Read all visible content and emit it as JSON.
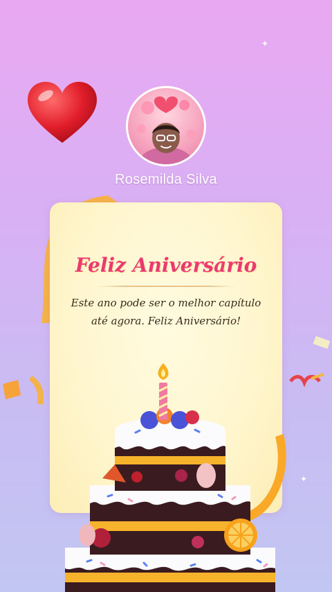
{
  "profile": {
    "name": "Rosemilda Silva"
  },
  "card": {
    "title": "Feliz Aniversário",
    "message": "Este ano pode ser o melhor capítulo até agora. Feliz Aniversário!"
  },
  "colors": {
    "title": "#ea3a70",
    "card_background": "#fff6cf",
    "page_top": "#e9a8f2",
    "page_bottom": "#c2c6f2"
  },
  "icons": {
    "heart": "heart-icon",
    "cake": "birthday-cake-icon",
    "candle": "candle-icon"
  }
}
